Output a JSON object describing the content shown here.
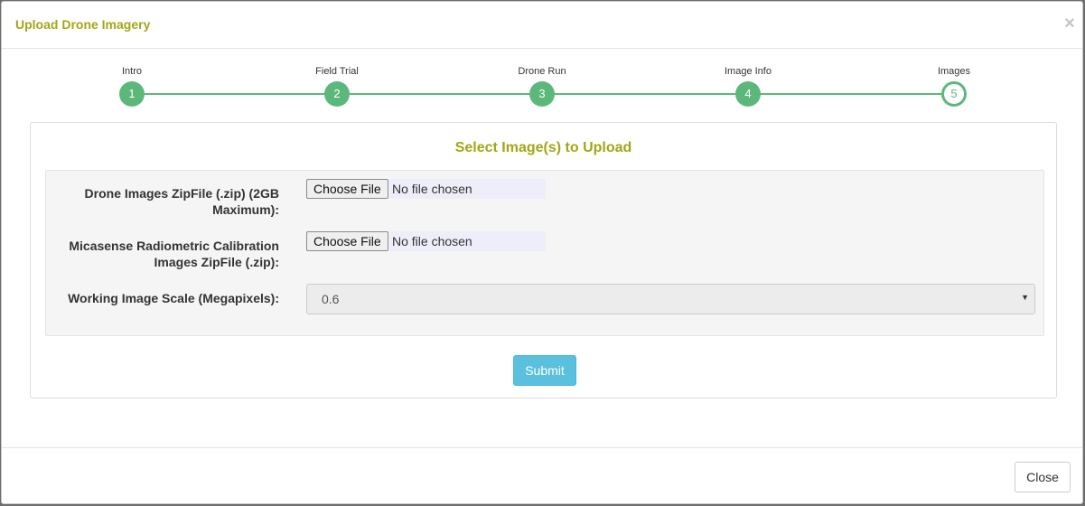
{
  "modal": {
    "title": "Upload Drone Imagery",
    "close_icon": "×"
  },
  "stepper": {
    "steps": [
      {
        "label": "Intro",
        "number": "1"
      },
      {
        "label": "Field Trial",
        "number": "2"
      },
      {
        "label": "Drone Run",
        "number": "3"
      },
      {
        "label": "Image Info",
        "number": "4"
      },
      {
        "label": "Images",
        "number": "5"
      }
    ],
    "active_step": 5
  },
  "section": {
    "title": "Select Image(s) to Upload"
  },
  "form": {
    "drone_zip": {
      "label": "Drone Images ZipFile (.zip) (2GB Maximum):",
      "button": "Choose File",
      "status": "No file chosen"
    },
    "calibration_zip": {
      "label": "Micasense Radiometric Calibration Images ZipFile (.zip):",
      "button": "Choose File",
      "status": "No file chosen"
    },
    "image_scale": {
      "label": "Working Image Scale (Megapixels):",
      "value": "0.6"
    },
    "submit_label": "Submit"
  },
  "footer": {
    "close_label": "Close"
  },
  "colors": {
    "title_accent": "#a3a613",
    "step_green": "#5cb87a",
    "submit_blue": "#5bc0de"
  },
  "icons": {
    "close": "close-icon",
    "select_caret": "chevron-down-icon"
  }
}
